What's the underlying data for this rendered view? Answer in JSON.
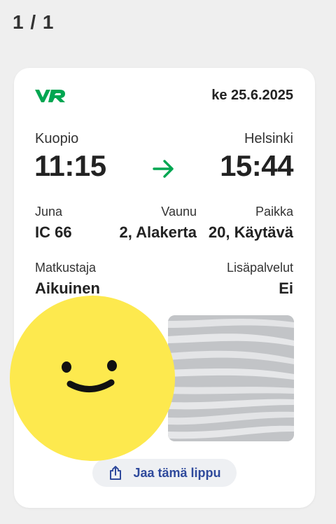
{
  "header": {
    "ticket_counter": "1 / 1"
  },
  "ticket": {
    "brand_logo": "VR",
    "date": "ke 25.6.2025",
    "from_city": "Kuopio",
    "to_city": "Helsinki",
    "departure_time": "11:15",
    "arrival_time": "15:44",
    "train_label": "Juna",
    "train_value": "IC 66",
    "car_label": "Vaunu",
    "car_value": "2, Alakerta",
    "seat_label": "Paikka",
    "seat_value": "20, Käytävä",
    "passenger_label": "Matkustaja",
    "passenger_value": "Aikuinen",
    "extras_label": "Lisäpalvelut",
    "extras_value": "Ei",
    "share_label": "Jaa tämä lippu"
  },
  "icons": {
    "route_arrow": "arrow-right-icon",
    "share": "share-icon",
    "overlay": "smiley-face-icon"
  },
  "colors": {
    "brand_green": "#00a651",
    "share_text": "#2f4a9c",
    "smiley_yellow": "#fde94e"
  }
}
